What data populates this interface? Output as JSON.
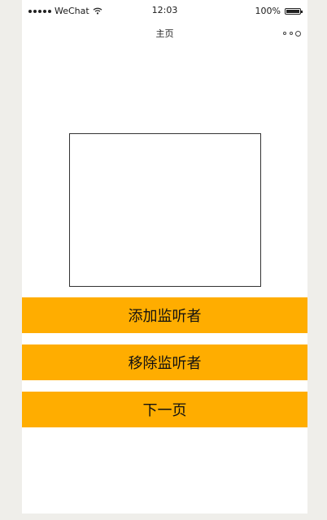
{
  "status_bar": {
    "carrier": "WeChat",
    "time": "12:03",
    "battery": "100%"
  },
  "nav": {
    "title": "主页"
  },
  "buttons": {
    "add_listener": "添加监听者",
    "remove_listener": "移除监听者",
    "next_page": "下一页"
  },
  "colors": {
    "button_bg": "#ffad00",
    "page_bg": "#efeeea"
  },
  "icons": {
    "wifi": "wifi-icon",
    "battery": "battery-icon",
    "menu": "more-options-icon"
  }
}
